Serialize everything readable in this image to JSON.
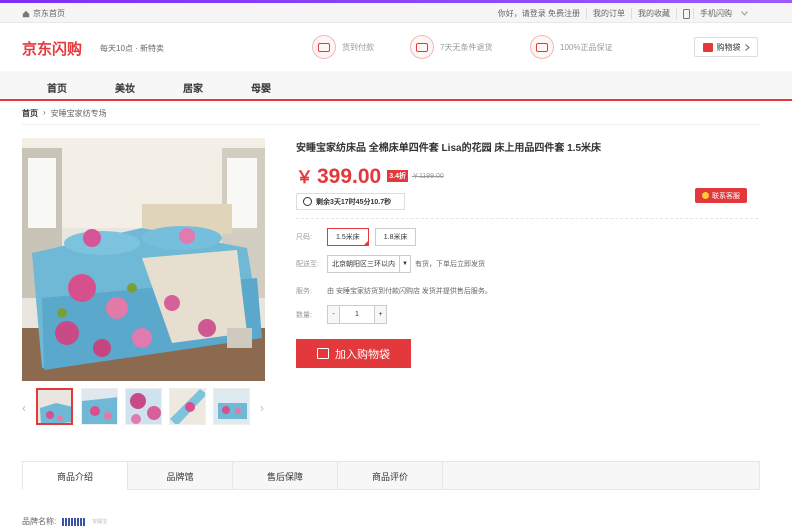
{
  "topbar": {
    "home": "京东首页",
    "greeting": "你好，请登录",
    "register": "免费注册",
    "orders": "我的订单",
    "favorites": "我的收藏",
    "mobile": "手机闪购"
  },
  "header": {
    "logo": "京东闪购",
    "slogan": "每天10点 · 新特卖",
    "promises": [
      "货到付款",
      "7天无条件退货",
      "100%正品保证"
    ],
    "cart": "购物袋"
  },
  "nav": {
    "items": [
      "首页",
      "美妆",
      "居家",
      "母婴"
    ]
  },
  "breadcrumb": {
    "home": "首页",
    "current": "安睡宝家纺专场"
  },
  "product": {
    "title": "安睡宝家纺床品 全棉床单四件套 Lisa的花园 床上用品四件套 1.5米床",
    "currency": "￥",
    "price": "399.00",
    "discount": "3.4折",
    "original_price": "￥1199.00",
    "countdown": "剩余3天17时45分10.7秒",
    "service_button": "联系客服",
    "size_label": "尺码:",
    "sizes": [
      "1.5米床",
      "1.8米床"
    ],
    "selected_size": "1.5米床",
    "delivery_label": "配送至:",
    "delivery_region": "北京朝阳区三环以内",
    "delivery_status": "有货，下单后立即发货",
    "service_label": "服务:",
    "service_text": "由 安睡宝家纺货到付款闪购店 发货并提供售后服务。",
    "qty_label": "数量:",
    "quantity": "1",
    "minus": "-",
    "plus": "+",
    "add_to_cart": "加入购物袋"
  },
  "tabs": [
    "商品介绍",
    "品牌馆",
    "售后保障",
    "商品评价"
  ],
  "brand": {
    "label": "品牌名称:",
    "logo_caption": "安睡宝"
  },
  "colors": {
    "accent": "#e4393c",
    "topline": "#7b2ff7"
  }
}
